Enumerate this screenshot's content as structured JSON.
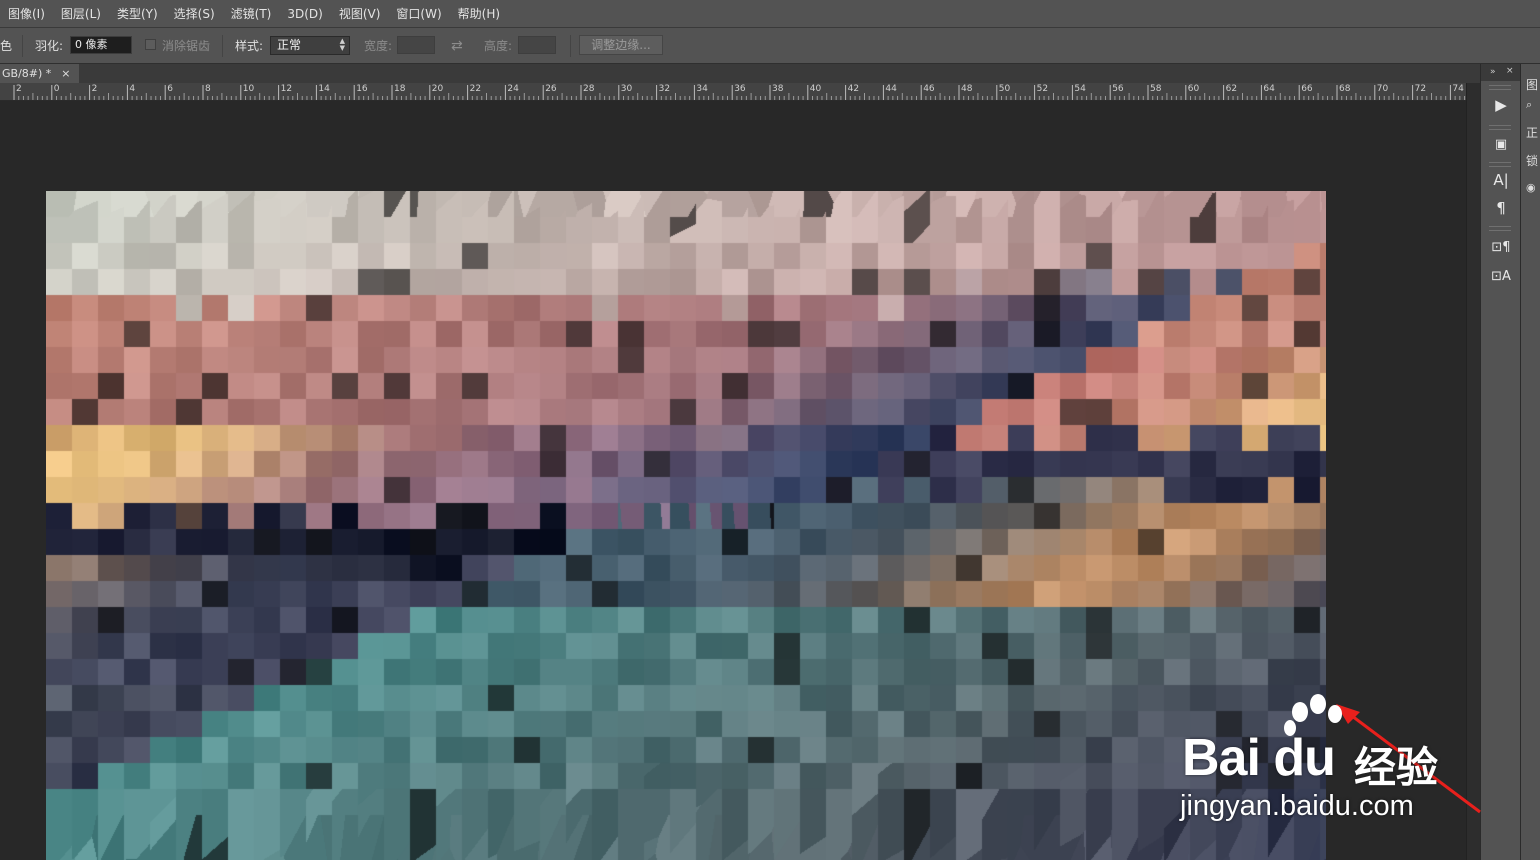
{
  "menu": [
    "图像(I)",
    "图层(L)",
    "类型(Y)",
    "选择(S)",
    "滤镜(T)",
    "3D(D)",
    "视图(V)",
    "窗口(W)",
    "帮助(H)"
  ],
  "options": {
    "left_glyph": "色",
    "feather_label": "羽化:",
    "feather_value": "0 像素",
    "antialias_label": "消除锯齿",
    "style_label": "样式:",
    "style_value": "正常",
    "width_label": "宽度:",
    "height_label": "高度:",
    "refine_edge_button": "调整边缘..."
  },
  "document_tab": {
    "title": "GB/8#) *",
    "close": "×"
  },
  "ruler": {
    "labels": [
      "2",
      "0",
      "2",
      "4",
      "6",
      "8",
      "10",
      "12",
      "14",
      "16",
      "18",
      "20",
      "22",
      "24",
      "26",
      "28",
      "30",
      "32",
      "34",
      "36",
      "38",
      "40",
      "42",
      "44",
      "46",
      "48",
      "50",
      "52",
      "54",
      "56",
      "58",
      "60",
      "62",
      "64",
      "66",
      "68",
      "70",
      "72",
      "74"
    ]
  },
  "panel_right": {
    "items": [
      "图",
      "正",
      "锁"
    ]
  },
  "watermark": {
    "logo": "Bai du",
    "product": "经验",
    "url": "jingyan.baidu.com"
  },
  "colors": {
    "annotation_arrow": "#e8201c"
  },
  "icons": [
    "play-icon",
    "image-adjust-icon",
    "character-icon",
    "paragraph-icon",
    "paragraph-style-icon",
    "character-style-icon",
    "search-icon",
    "eye-icon"
  ]
}
